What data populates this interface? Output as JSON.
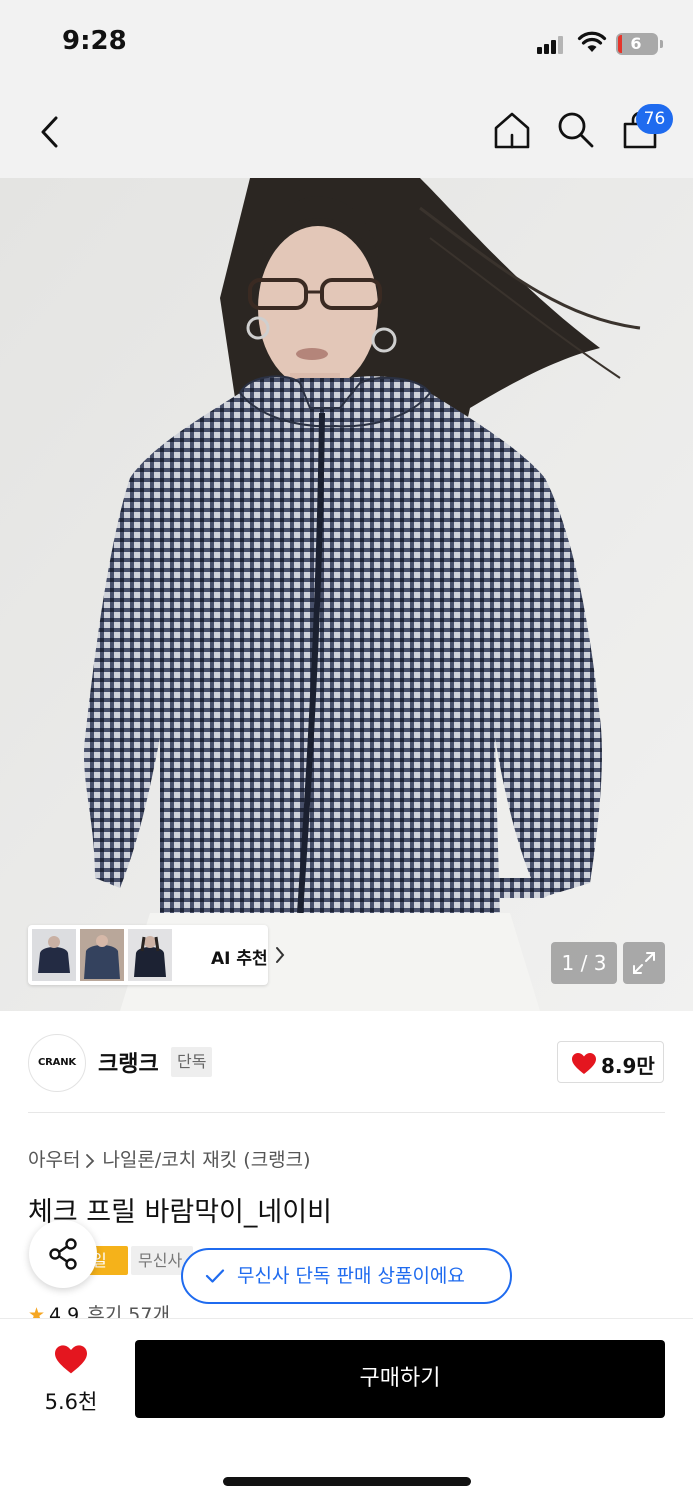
{
  "status_bar": {
    "time": "9:28",
    "battery": "6"
  },
  "nav": {
    "cart_count": "76",
    "icons": [
      "back-icon",
      "home-icon",
      "search-icon",
      "cart-icon"
    ]
  },
  "gallery": {
    "ai_label": "AI 추천",
    "page_indicator": "1 / 3",
    "thumbnail_count": 3
  },
  "brand": {
    "logo_text": "CRANK",
    "name": "크랭크",
    "badge": "단독",
    "like_count": "8.9만"
  },
  "product": {
    "breadcrumb": [
      "아우터",
      "나일론/코치 재킷 (크랭크)"
    ],
    "title": "체크 프릴 바람막이_네이비",
    "tag_yellow": "일",
    "tag_grey": "무신사",
    "rating": {
      "star": "★",
      "score": "4.9",
      "reviews": "후기 57개"
    }
  },
  "toast": {
    "text": "무신사 단독 판매 상품이에요"
  },
  "bottom": {
    "like_count": "5.6천",
    "buy_label": "구매하기"
  },
  "colors": {
    "accent": "#1f6bef",
    "like": "#e4161f",
    "primary_button": "#000000",
    "tag_yellow": "#f5b21a"
  }
}
